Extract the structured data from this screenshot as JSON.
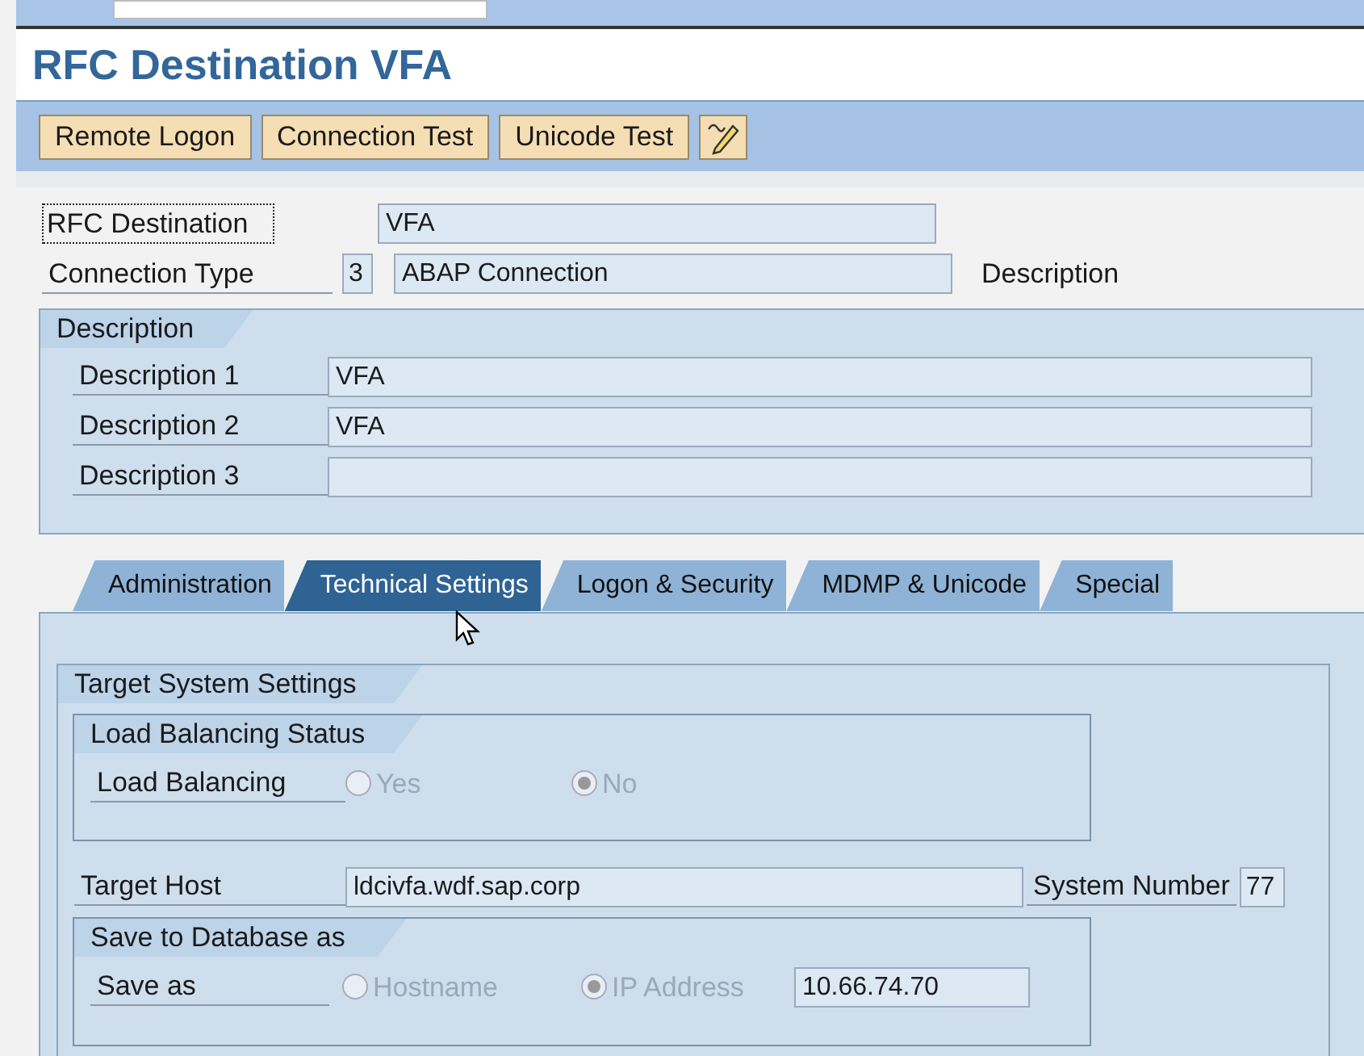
{
  "title": "RFC Destination VFA",
  "toolbar": [
    {
      "kind": "text",
      "label": "Remote Logon"
    },
    {
      "kind": "text",
      "label": "Connection Test"
    },
    {
      "kind": "text",
      "label": "Unicode Test"
    },
    {
      "kind": "icon"
    }
  ],
  "header": {
    "destination": {
      "label": "RFC Destination",
      "focused": true,
      "value": "VFA"
    },
    "connection_type": {
      "label": "Connection Type",
      "code": "3",
      "value": "ABAP Connection",
      "note": "Description"
    }
  },
  "description_group": {
    "title": "Description",
    "rows": [
      {
        "label": "Description 1",
        "value": "VFA"
      },
      {
        "label": "Description 2",
        "value": "VFA"
      },
      {
        "label": "Description 3"
      }
    ]
  },
  "tabs": [
    {
      "label": "Administration",
      "selected": false
    },
    {
      "label": "Technical Settings",
      "selected": true
    },
    {
      "label": "Logon & Security",
      "selected": false
    },
    {
      "label": "MDMP & Unicode",
      "selected": false
    },
    {
      "label": "Special",
      "selected": false
    }
  ],
  "target_system": {
    "title": "Target System Settings",
    "load_balancing": {
      "title": "Load Balancing Status",
      "label": "Load Balancing",
      "options": [
        {
          "label": "Yes",
          "selected": false,
          "disabled": true
        },
        {
          "label": "No",
          "selected": true,
          "disabled": true
        }
      ]
    },
    "target_host": {
      "label": "Target Host",
      "value": "ldcivfa.wdf.sap.corp"
    },
    "system_number": {
      "label": "System Number",
      "value": "77"
    },
    "save_to_db": {
      "title": "Save to Database as",
      "label": "Save as",
      "options": [
        {
          "label": "Hostname",
          "selected": false,
          "disabled": true
        },
        {
          "label": "IP Address",
          "selected": true,
          "disabled": true
        }
      ],
      "value": "10.66.74.70"
    }
  }
}
